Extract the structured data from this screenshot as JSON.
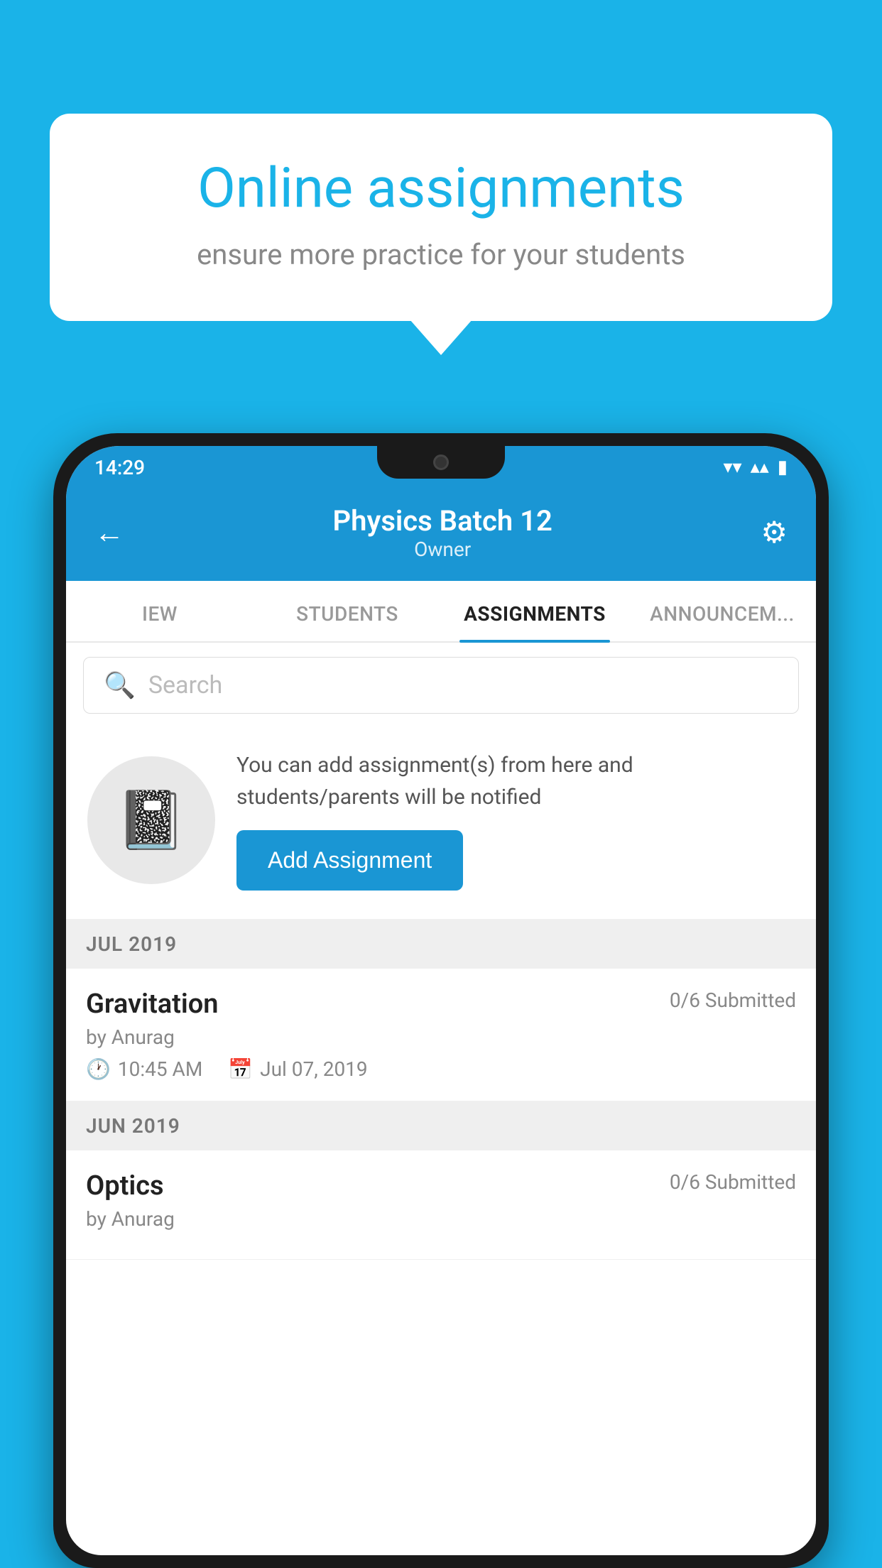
{
  "background_color": "#1ab3e8",
  "speech_bubble": {
    "title": "Online assignments",
    "subtitle": "ensure more practice for your students"
  },
  "status_bar": {
    "time": "14:29",
    "wifi_icon": "▾",
    "signal_icon": "▴",
    "battery_icon": "▮"
  },
  "header": {
    "title": "Physics Batch 12",
    "subtitle": "Owner",
    "back_label": "←",
    "settings_label": "⚙"
  },
  "tabs": [
    {
      "label": "IEW",
      "active": false
    },
    {
      "label": "STUDENTS",
      "active": false
    },
    {
      "label": "ASSIGNMENTS",
      "active": true
    },
    {
      "label": "ANNOUNCEM...",
      "active": false
    }
  ],
  "search": {
    "placeholder": "Search"
  },
  "promo": {
    "description": "You can add assignment(s) from here and students/parents will be notified",
    "button_label": "Add Assignment"
  },
  "sections": [
    {
      "label": "JUL 2019",
      "assignments": [
        {
          "title": "Gravitation",
          "submitted": "0/6 Submitted",
          "author": "by Anurag",
          "time": "10:45 AM",
          "date": "Jul 07, 2019"
        }
      ]
    },
    {
      "label": "JUN 2019",
      "assignments": [
        {
          "title": "Optics",
          "submitted": "0/6 Submitted",
          "author": "by Anurag",
          "time": "",
          "date": ""
        }
      ]
    }
  ]
}
